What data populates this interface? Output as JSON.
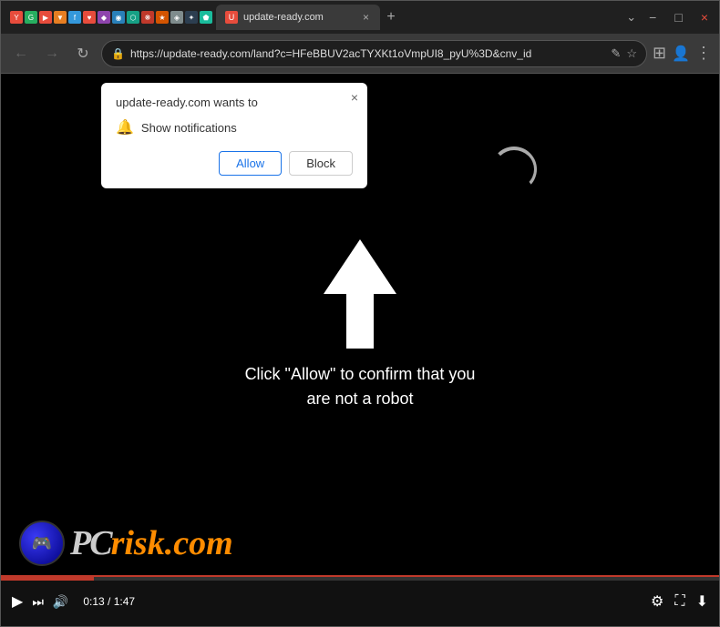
{
  "titleBar": {
    "tab": {
      "title": "update-ready.com",
      "close": "×"
    },
    "newTab": "+",
    "controls": {
      "minimize": "−",
      "maximize": "□",
      "close": "×"
    }
  },
  "toolbar": {
    "back": "←",
    "forward": "→",
    "reload": "↻",
    "address": "https://update-ready.com/land?c=HFeBBUV2acTYXKt1oVmpUI8_pyU%3D&cnv_id",
    "bookmarkIcon": "☆",
    "menuIcon": "⋮"
  },
  "popup": {
    "title": "update-ready.com wants to",
    "closeBtn": "×",
    "permission": "Show notifications",
    "allowLabel": "Allow",
    "blockLabel": "Block"
  },
  "pageContent": {
    "clickText": "Click \"Allow\" to confirm that you\nare not a robot"
  },
  "videoBar": {
    "playBtn": "▶",
    "skipBtn": "⏭",
    "volumeBtn": "🔊",
    "timeText": "0:13 / 1:47",
    "settingsBtn": "⚙",
    "fullscreenBtn": "⛶",
    "downloadBtn": "⬇"
  },
  "logo": {
    "pcText": "PC",
    "riskText": "risk.com"
  }
}
